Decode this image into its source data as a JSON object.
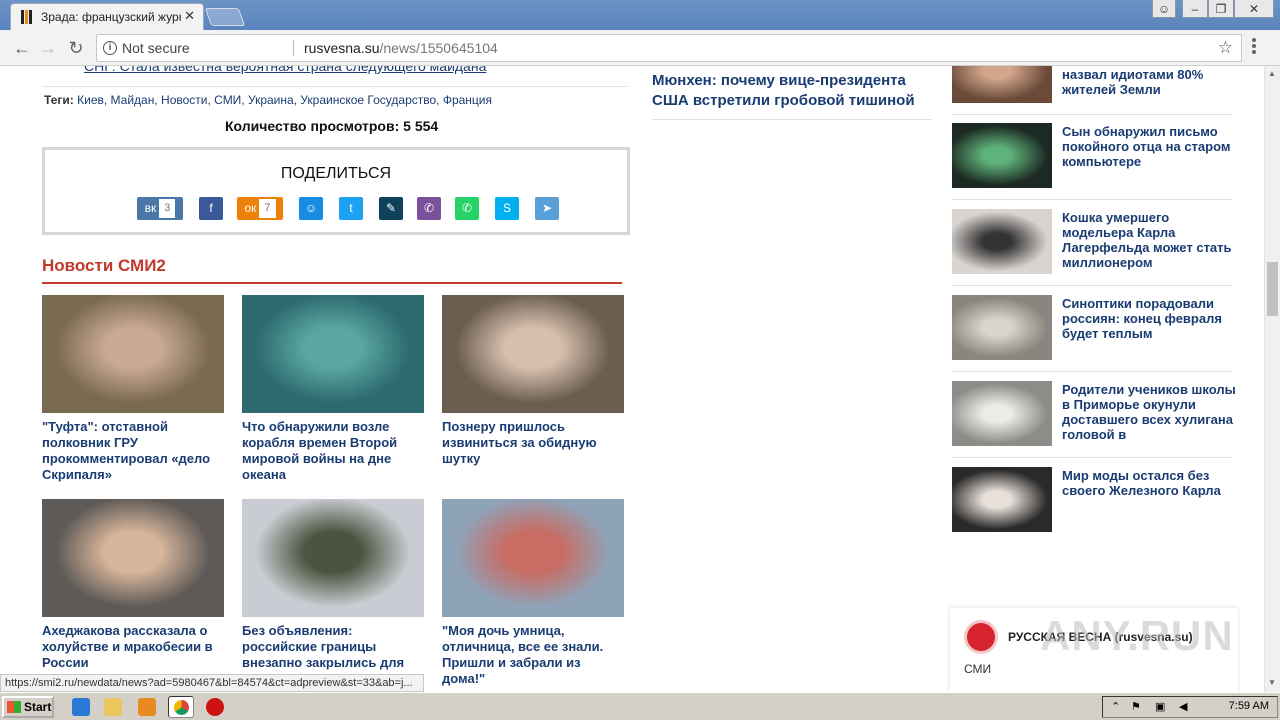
{
  "browser": {
    "tab_title": "Зрада: французский журн",
    "tab_close": "✕",
    "not_secure": "Not secure",
    "url_domain": "rusvesna.su",
    "url_path": "/news/1550645104",
    "status_url": "https://smi2.ru/newdata/news?ad=5980467&bl=84574&ct=adpreview&st=33&ab=j..."
  },
  "article": {
    "cut_link": "СНГ: Стала известна вероятная страна следующего майдана",
    "tags_label": "Теги:",
    "tags": [
      "Киев",
      "Майдан",
      "Новости",
      "СМИ",
      "Украина",
      "Украинское Государство",
      "Франция"
    ],
    "views": "Количество просмотров: 5 554"
  },
  "share": {
    "title": "ПОДЕЛИТЬСЯ",
    "buttons": [
      {
        "name": "vk",
        "label": "вк",
        "count": "3",
        "color": "#4a76a8"
      },
      {
        "name": "facebook",
        "label": "f",
        "color": "#3b5998"
      },
      {
        "name": "odnoklassniki",
        "label": "ок",
        "count": "7",
        "color": "#ee8208"
      },
      {
        "name": "moimir",
        "label": "☺",
        "color": "#168de2"
      },
      {
        "name": "twitter",
        "label": "t",
        "color": "#1da1f2"
      },
      {
        "name": "livejournal",
        "label": "✎",
        "color": "#0d425a"
      },
      {
        "name": "viber",
        "label": "✆",
        "color": "#7b519d"
      },
      {
        "name": "whatsapp",
        "label": "✆",
        "color": "#25d366"
      },
      {
        "name": "skype",
        "label": "S",
        "color": "#00aff0"
      },
      {
        "name": "telegram",
        "label": "➤",
        "color": "#5aa0d8"
      }
    ]
  },
  "smi": {
    "heading": "Новости СМИ2",
    "cards": [
      {
        "title": "\"Туфта\": отставной полковник ГРУ прокомментировал «дело Скрипаля»",
        "bg": "#7a6a4f",
        "accent": "#c9a896"
      },
      {
        "title": "Что обнаружили возле корабля времен Второй мировой войны на дне океана",
        "bg": "#2c6a6f",
        "accent": "#5aa6a0"
      },
      {
        "title": "Познеру пришлось извиниться за обидную шутку",
        "bg": "#6b5e4f",
        "accent": "#d7bfae"
      },
      {
        "title": "Ахеджакова рассказала о холуйстве и мракобесии в России",
        "bg": "#5e5a57",
        "accent": "#d8b69b"
      },
      {
        "title": "Без объявления: российские границы внезапно закрылись для",
        "bg": "#c9ccd2",
        "accent": "#4c5440"
      },
      {
        "title": "\"Моя дочь умница, отличница, все ее знали. Пришли и забрали из дома!\"",
        "bg": "#8fa3b8",
        "accent": "#c96c63"
      }
    ]
  },
  "middle": {
    "title": "Мюнхен: почему вице-президента США встретили гробовой тишиной"
  },
  "sidebar": {
    "items": [
      {
        "title": "назвал идиотами 80% жителей Земли",
        "bg": "#6b4a3a",
        "accent": "#d1a68a"
      },
      {
        "title": "Сын обнаружил письмо покойного отца на старом компьютере",
        "bg": "#1c2a23",
        "accent": "#5fb27a"
      },
      {
        "title": "Кошка умершего модельера Карла Лагерфельда может стать миллионером",
        "bg": "#d9d4d0",
        "accent": "#333"
      },
      {
        "title": "Синоптики порадовали россиян: конец февраля будет теплым",
        "bg": "#8a857e",
        "accent": "#d8d5cc"
      },
      {
        "title": "Родители учеников школы в Приморье окунули доставшего всех хулигана головой в",
        "bg": "#8e8c88",
        "accent": "#ecebe8"
      },
      {
        "title": "Мир моды остался без своего Железного Карла",
        "bg": "#2a2a2a",
        "accent": "#e8e0da"
      }
    ]
  },
  "widget": {
    "name": "РУССКАЯ ВЕСНА (rusvesna.su)",
    "smi": "СМИ",
    "watermark": "ANY.RUN"
  },
  "taskbar": {
    "start": "Start",
    "clock": "7:59 AM"
  }
}
